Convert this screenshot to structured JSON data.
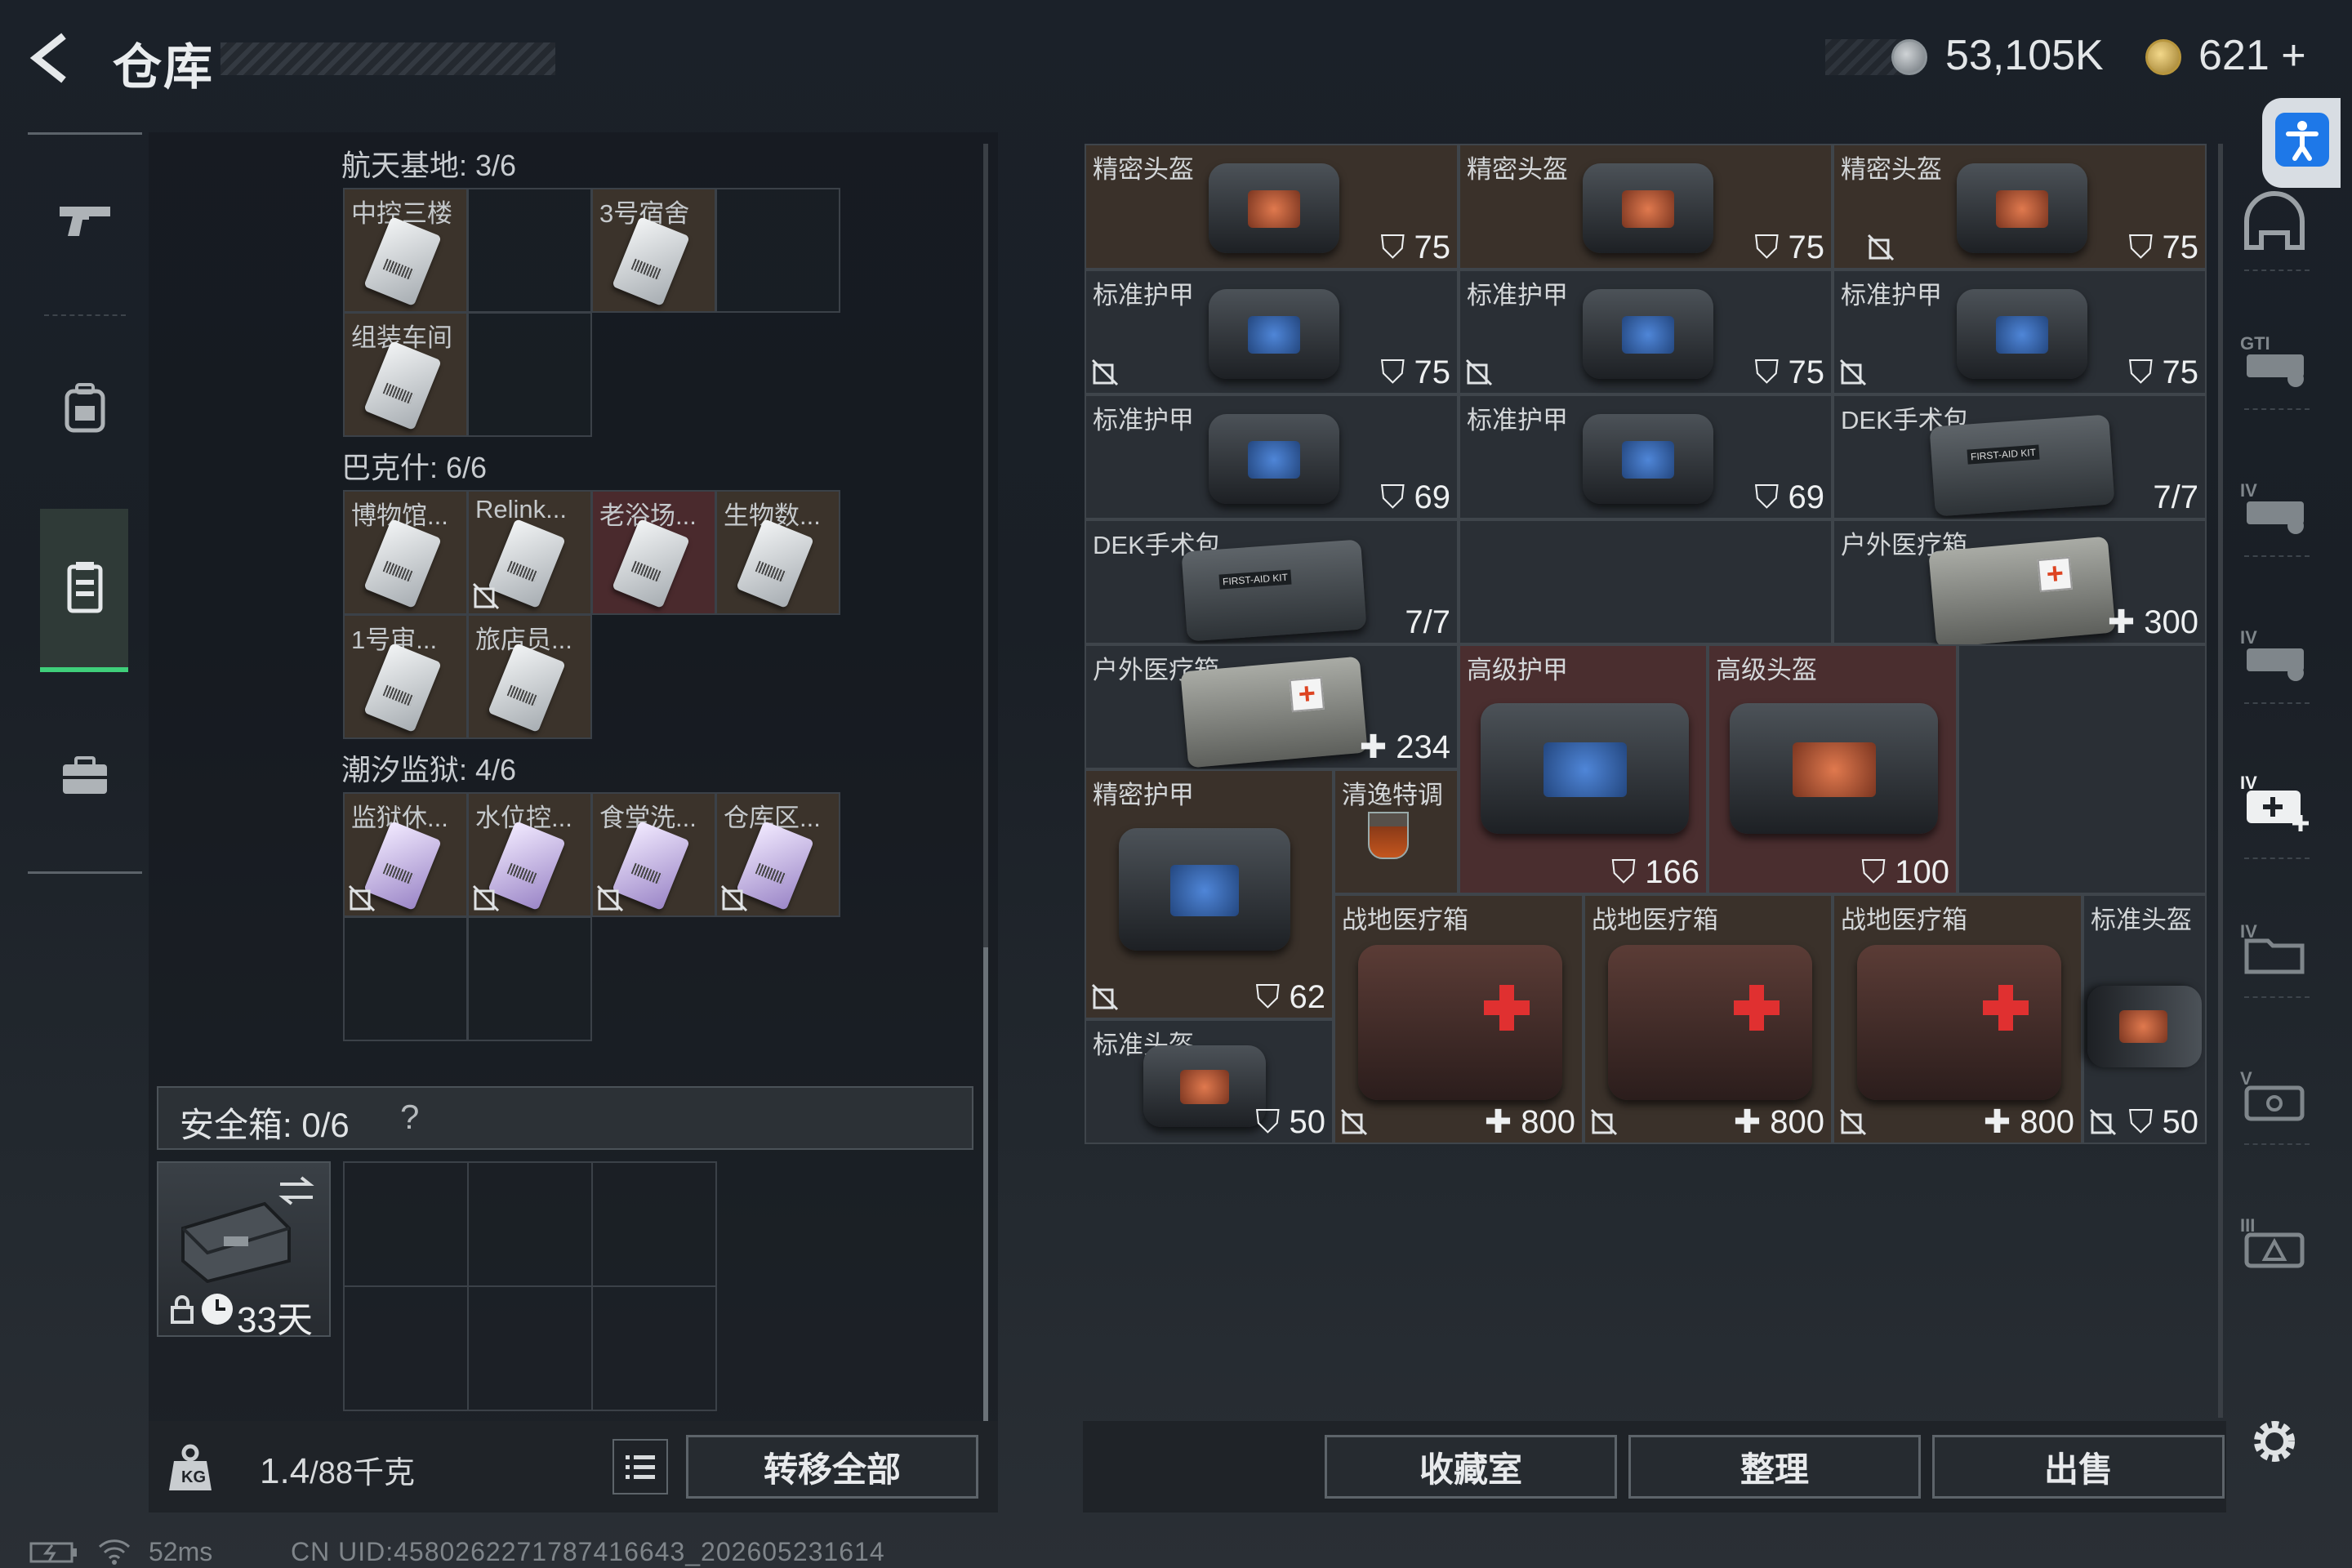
{
  "header": {
    "title": "仓库"
  },
  "currency": [
    {
      "icon": "silver-coin-icon",
      "value": "53,105K"
    },
    {
      "icon": "gold-coin-icon",
      "value": "621",
      "plus": "+"
    }
  ],
  "left_nav": [
    "pistol-icon",
    "backpack-icon",
    "vest-icon",
    "case-icon"
  ],
  "stash": {
    "sections": [
      {
        "title": "航天基地: 3/6",
        "items": [
          "中控三楼",
          "3号宿舍",
          "组装车间"
        ]
      },
      {
        "title": "巴克什: 6/6",
        "items": [
          "博物馆...",
          "Relink...",
          "老浴场...",
          "生物数...",
          "1号审...",
          "旅店员..."
        ]
      },
      {
        "title": "潮汐监狱: 4/6",
        "items": [
          "监狱休...",
          "水位控...",
          "食堂洗...",
          "仓库区..."
        ]
      }
    ],
    "safe_box": {
      "label": "安全箱: 0/6",
      "help": "?",
      "days": "33天"
    },
    "weight": {
      "current": "1.4",
      "max": "/88千克"
    },
    "transfer_all": "转移全部"
  },
  "inventory": [
    {
      "name": "精密头盔",
      "value": "75",
      "stat": "shield"
    },
    {
      "name": "精密头盔",
      "value": "75",
      "stat": "shield"
    },
    {
      "name": "精密头盔",
      "value": "75",
      "stat": "shield"
    },
    {
      "name": "标准护甲",
      "value": "75",
      "stat": "shield"
    },
    {
      "name": "标准护甲",
      "value": "75",
      "stat": "shield"
    },
    {
      "name": "标准护甲",
      "value": "75",
      "stat": "shield"
    },
    {
      "name": "标准护甲",
      "value": "69",
      "stat": "shield"
    },
    {
      "name": "标准护甲",
      "value": "69",
      "stat": "shield"
    },
    {
      "name": "DEK手术包",
      "value": "7/7",
      "stat": "uses"
    },
    {
      "name": "DEK手术包",
      "value": "7/7",
      "stat": "uses"
    },
    {
      "name": "户外医疗箱",
      "value": "300",
      "stat": "heal"
    },
    {
      "name": "户外医疗箱",
      "value": "234",
      "stat": "heal"
    },
    {
      "name": "高级护甲",
      "value": "166",
      "stat": "shield"
    },
    {
      "name": "高级头盔",
      "value": "100",
      "stat": "shield"
    },
    {
      "name": "精密护甲",
      "value": "62",
      "stat": "shield"
    },
    {
      "name": "清逸特调",
      "value": "",
      "stat": "none"
    },
    {
      "name": "战地医疗箱",
      "value": "800",
      "stat": "heal"
    },
    {
      "name": "战地医疗箱",
      "value": "800",
      "stat": "heal"
    },
    {
      "name": "战地医疗箱",
      "value": "800",
      "stat": "heal"
    },
    {
      "name": "标准头盔",
      "value": "50",
      "stat": "shield"
    },
    {
      "name": "标准头盔",
      "value": "50",
      "stat": "shield"
    }
  ],
  "right_nav": [
    "helmet-icon",
    "GTI-rig-icon",
    "IV-rig-icon",
    "IV-rig-icon",
    "IV-medkit-icon",
    "IV-folder-icon",
    "V-case-icon",
    "III-case-icon"
  ],
  "buttons": {
    "collection": "收藏室",
    "sort": "整理",
    "sell": "出售"
  },
  "status": {
    "ping": "52ms",
    "uid": "CN UID:4580262271787416643_202605231614"
  }
}
